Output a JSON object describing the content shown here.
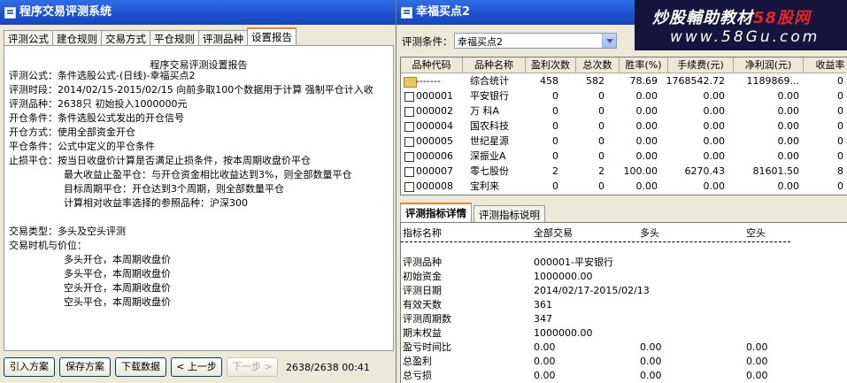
{
  "left_window": {
    "title": "程序交易评测系统",
    "tabs": [
      "评测公式",
      "建仓规则",
      "交易方式",
      "平仓规则",
      "评测品种",
      "设置报告"
    ],
    "active_tab": "设置报告",
    "report_title": "程序交易评测设置报告",
    "lines": [
      "评测公式：条件选股公式-(日线)-幸福买点2",
      "评测时段：2014/02/15-2015/02/15 向前多取100个数据用于计算 强制平仓计入收",
      "评测品种：2638只 初始投入1000000元",
      "开仓条件：条件选股公式发出的开仓信号",
      "开仓方式：使用全部资金开仓",
      "平仓条件：公式中定义的平仓条件",
      "止损平仓：按当日收盘价计算是否满足止损条件，按本周期收盘价平仓",
      "最大收益止盈平仓：与开仓资金相比收益达到3%，则全部数量平仓",
      "目标周期平仓：开仓达到3个周期，则全部数量平仓",
      "计算相对收益率选择的参照品种：沪深300",
      "交易类型：多头及空头评测",
      "交易时机与价位：",
      "多头开仓，本周期收盘价",
      "多头平仓，本周期收盘价",
      "空头开仓，本周期收盘价",
      "空头平仓，本周期收盘价"
    ],
    "buttons": {
      "import": "引入方案",
      "save": "保存方案",
      "download": "下载数据",
      "prev": "< 上一步",
      "next": "下一步 >"
    },
    "status": "2638/2638 00:41"
  },
  "right_window": {
    "title": "幸福买点2",
    "brand_line1": "炒股輔助教材",
    "brand_line1_red": "58股网",
    "brand_line2": "www.58Gu.com",
    "criteria_label": "评测条件：",
    "criteria_value": "幸福买点2",
    "columns": [
      "品种代码",
      "品种名称",
      "盈利次数",
      "总次数",
      "胜率(%)",
      "手续费(元)",
      "净利润(元)",
      "收益率"
    ],
    "rows": [
      {
        "code": "-------",
        "name": "综合统计",
        "wins": "458",
        "total": "582",
        "rate": "78.69",
        "fee": "1768542.72",
        "profit": "1189869...",
        "ret": "0"
      },
      {
        "code": "000001",
        "name": "平安银行",
        "wins": "0",
        "total": "0",
        "rate": "0.00",
        "fee": "0.00",
        "profit": "0.00",
        "ret": "0"
      },
      {
        "code": "000002",
        "name": "万  科A",
        "wins": "0",
        "total": "0",
        "rate": "0.00",
        "fee": "0.00",
        "profit": "0.00",
        "ret": "0"
      },
      {
        "code": "000004",
        "name": "国农科技",
        "wins": "0",
        "total": "0",
        "rate": "0.00",
        "fee": "0.00",
        "profit": "0.00",
        "ret": "0"
      },
      {
        "code": "000005",
        "name": "世纪星源",
        "wins": "0",
        "total": "0",
        "rate": "0.00",
        "fee": "0.00",
        "profit": "0.00",
        "ret": "0"
      },
      {
        "code": "000006",
        "name": "深振业A",
        "wins": "0",
        "total": "0",
        "rate": "0.00",
        "fee": "0.00",
        "profit": "0.00",
        "ret": "0"
      },
      {
        "code": "000007",
        "name": "零七股份",
        "wins": "2",
        "total": "2",
        "rate": "100.00",
        "fee": "6270.43",
        "profit": "81601.50",
        "ret": "8"
      },
      {
        "code": "000008",
        "name": "宝利来",
        "wins": "0",
        "total": "0",
        "rate": "0.00",
        "fee": "0.00",
        "profit": "0.00",
        "ret": "0"
      }
    ],
    "bottom_tabs": [
      "评测指标详情",
      "评测指标说明"
    ],
    "detail_header": [
      "指标名称",
      "全部交易",
      "多头",
      "空头"
    ],
    "detail_rows": [
      {
        "name": "评测品种",
        "all": "000001-平安银行",
        "long": "",
        "short": ""
      },
      {
        "name": "初始资金",
        "all": "1000000.00",
        "long": "",
        "short": ""
      },
      {
        "name": "评测日期",
        "all": "2014/02/17-2015/02/13",
        "long": "",
        "short": ""
      },
      {
        "name": "有效天数",
        "all": "361",
        "long": "",
        "short": ""
      },
      {
        "name": "评测周期数",
        "all": "347",
        "long": "",
        "short": ""
      },
      {
        "name": "期末权益",
        "all": "1000000.00",
        "long": "",
        "short": ""
      },
      {
        "name": "盈亏时间比",
        "all": "0.00",
        "long": "0.00",
        "short": "0.00"
      },
      {
        "name": "总盈利",
        "all": "0.00",
        "long": "0.00",
        "short": "0.00"
      },
      {
        "name": "总亏损",
        "all": "0.00",
        "long": "0.00",
        "short": "0.00"
      }
    ]
  }
}
